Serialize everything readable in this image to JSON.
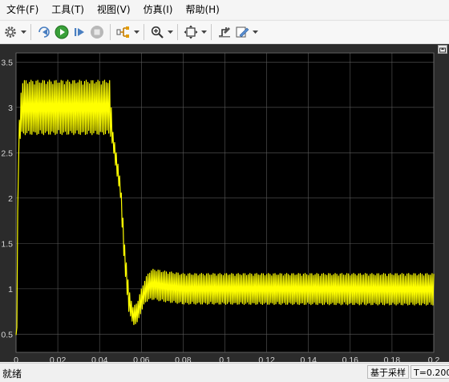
{
  "menu": [
    "文件(F)",
    "工具(T)",
    "视图(V)",
    "仿真(I)",
    "帮助(H)"
  ],
  "toolbar": {
    "buttons": [
      "gear-icon",
      "step-back-icon",
      "run-icon",
      "step-forward-icon",
      "stop-icon",
      "highlight-signal-icon",
      "zoom-in-icon",
      "fit-to-view-icon",
      "triggers-icon",
      "style-icon"
    ]
  },
  "status": {
    "ready": "就绪",
    "sample_mode": "基于采样",
    "time": "T=0.200"
  },
  "colors": {
    "plot_background": "#000000",
    "figure_background": "#2b2b2b",
    "trace": "#ffff00",
    "grid": "#5a5a5a",
    "axis_text": "#d6d6d6"
  },
  "chart_data": {
    "type": "line",
    "title": "",
    "xlabel": "",
    "ylabel": "",
    "xlim": [
      0,
      0.2
    ],
    "ylim": [
      0.3,
      3.6
    ],
    "xticks": [
      "0",
      "0.02",
      "0.04",
      "0.06",
      "0.08",
      "0.1",
      "0.12",
      "0.14",
      "0.16",
      "0.18",
      "0.2"
    ],
    "yticks": [
      "0.5",
      "1",
      "1.5",
      "2",
      "2.5",
      "3",
      "3.5"
    ],
    "grid": true,
    "series": [
      {
        "name": "",
        "envelope_upper_x": [
          0,
          0.0005,
          0.001,
          0.002,
          0.003,
          0.004,
          0.045,
          0.046,
          0.05,
          0.052,
          0.054,
          0.056,
          0.058,
          0.06,
          0.062,
          0.064,
          0.066,
          0.07,
          0.08,
          0.2
        ],
        "envelope_upper_y": [
          0.5,
          0.9,
          2.5,
          3.1,
          3.3,
          3.3,
          3.3,
          2.8,
          2.2,
          1.5,
          1.0,
          0.8,
          0.85,
          1.0,
          1.12,
          1.2,
          1.22,
          1.2,
          1.17,
          1.17
        ],
        "envelope_lower_x": [
          0,
          0.0005,
          0.001,
          0.002,
          0.003,
          0.004,
          0.045,
          0.046,
          0.05,
          0.052,
          0.054,
          0.056,
          0.058,
          0.06,
          0.062,
          0.064,
          0.066,
          0.07,
          0.08,
          0.2
        ],
        "envelope_lower_y": [
          0.4,
          0.6,
          2.3,
          2.65,
          2.7,
          2.7,
          2.7,
          2.6,
          2.0,
          1.2,
          0.75,
          0.6,
          0.62,
          0.75,
          0.85,
          0.88,
          0.88,
          0.86,
          0.83,
          0.82
        ],
        "ripple_period": 0.0008
      }
    ]
  }
}
